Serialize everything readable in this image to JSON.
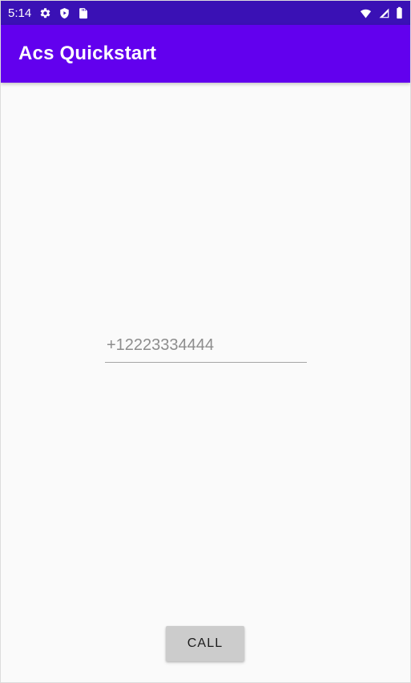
{
  "status_bar": {
    "time": "5:14",
    "background_color": "#3A11B5",
    "left_icons": [
      {
        "name": "settings-gear-icon",
        "label": "Settings"
      },
      {
        "name": "play-protect-shield-icon",
        "label": "Play Protect"
      },
      {
        "name": "sd-card-icon",
        "label": "SD Card"
      }
    ],
    "right_icons": [
      {
        "name": "wifi-icon",
        "label": "Wi-Fi"
      },
      {
        "name": "cellular-signal-icon",
        "label": "Cellular signal"
      },
      {
        "name": "battery-icon",
        "label": "Battery full"
      }
    ]
  },
  "app_bar": {
    "title": "Acs Quickstart",
    "background_color": "#6200EE",
    "title_color": "#FFFFFF"
  },
  "main": {
    "background_color": "#FAFAFA",
    "phone_input": {
      "value": "+12223334444",
      "placeholder": "+12223334444",
      "text_color": "#7A7A7A",
      "underline_color": "#A6A6A6"
    },
    "call_button": {
      "label": "CALL",
      "background_color": "#CCCCCC",
      "text_color": "#1C1C1C"
    }
  }
}
